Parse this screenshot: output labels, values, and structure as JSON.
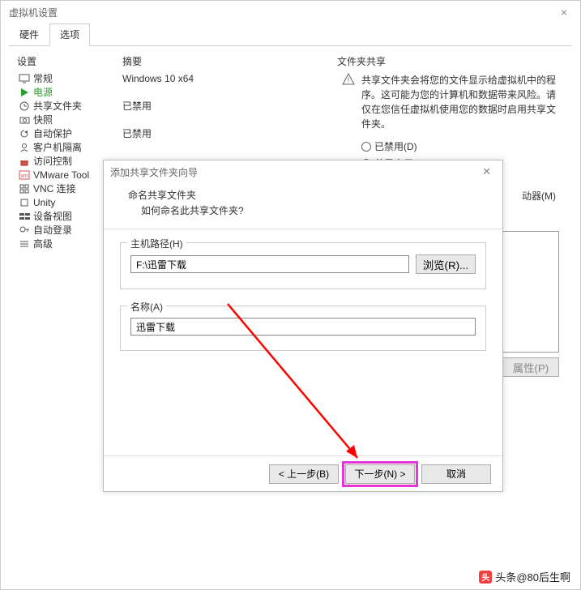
{
  "window": {
    "title": "虚拟机设置"
  },
  "tabs": {
    "hardware": "硬件",
    "options": "选项"
  },
  "columns": {
    "setting": "设置",
    "summary": "摘要"
  },
  "settings": [
    {
      "icon": "monitor",
      "label": "常规",
      "summary": "Windows 10 x64"
    },
    {
      "icon": "play",
      "label": "电源",
      "summary": ""
    },
    {
      "icon": "clock",
      "label": "共享文件夹",
      "summary": "已禁用"
    },
    {
      "icon": "camera",
      "label": "快照",
      "summary": ""
    },
    {
      "icon": "refresh",
      "label": "自动保护",
      "summary": "已禁用"
    },
    {
      "icon": "user",
      "label": "客户机隔离",
      "summary": ""
    },
    {
      "icon": "lock",
      "label": "访问控制",
      "summary": ""
    },
    {
      "icon": "vm",
      "label": "VMware Tool",
      "summary": ""
    },
    {
      "icon": "grid",
      "label": "VNC 连接",
      "summary": ""
    },
    {
      "icon": "box",
      "label": "Unity",
      "summary": ""
    },
    {
      "icon": "tool",
      "label": "设备视图",
      "summary": ""
    },
    {
      "icon": "key",
      "label": "自动登录",
      "summary": ""
    },
    {
      "icon": "bars",
      "label": "高级",
      "summary": ""
    }
  ],
  "rightPane": {
    "groupLabel": "文件夹共享",
    "warning": "共享文件夹会将您的文件显示给虚拟机中的程序。这可能为您的计算机和数据带来风险。请仅在您信任虚拟机使用您的数据时启用共享文件夹。",
    "radioDisabled": "已禁用(D)",
    "radioAlways": "总是启用(E)",
    "mapDrive": "动器(M)",
    "propertiesBtn": "属性(P)"
  },
  "wizard": {
    "title": "添加共享文件夹向导",
    "heading": "命名共享文件夹",
    "subheading": "如何命名此共享文件夹?",
    "hostPathLabel": "主机路径(H)",
    "hostPathValue": "F:\\迅雷下载",
    "browseBtn": "浏览(R)...",
    "nameLabel": "名称(A)",
    "nameValue": "迅雷下载",
    "backBtn": "< 上一步(B)",
    "nextBtn": "下一步(N) >",
    "cancelBtn": "取消"
  },
  "watermark": "头条@80后生啊"
}
